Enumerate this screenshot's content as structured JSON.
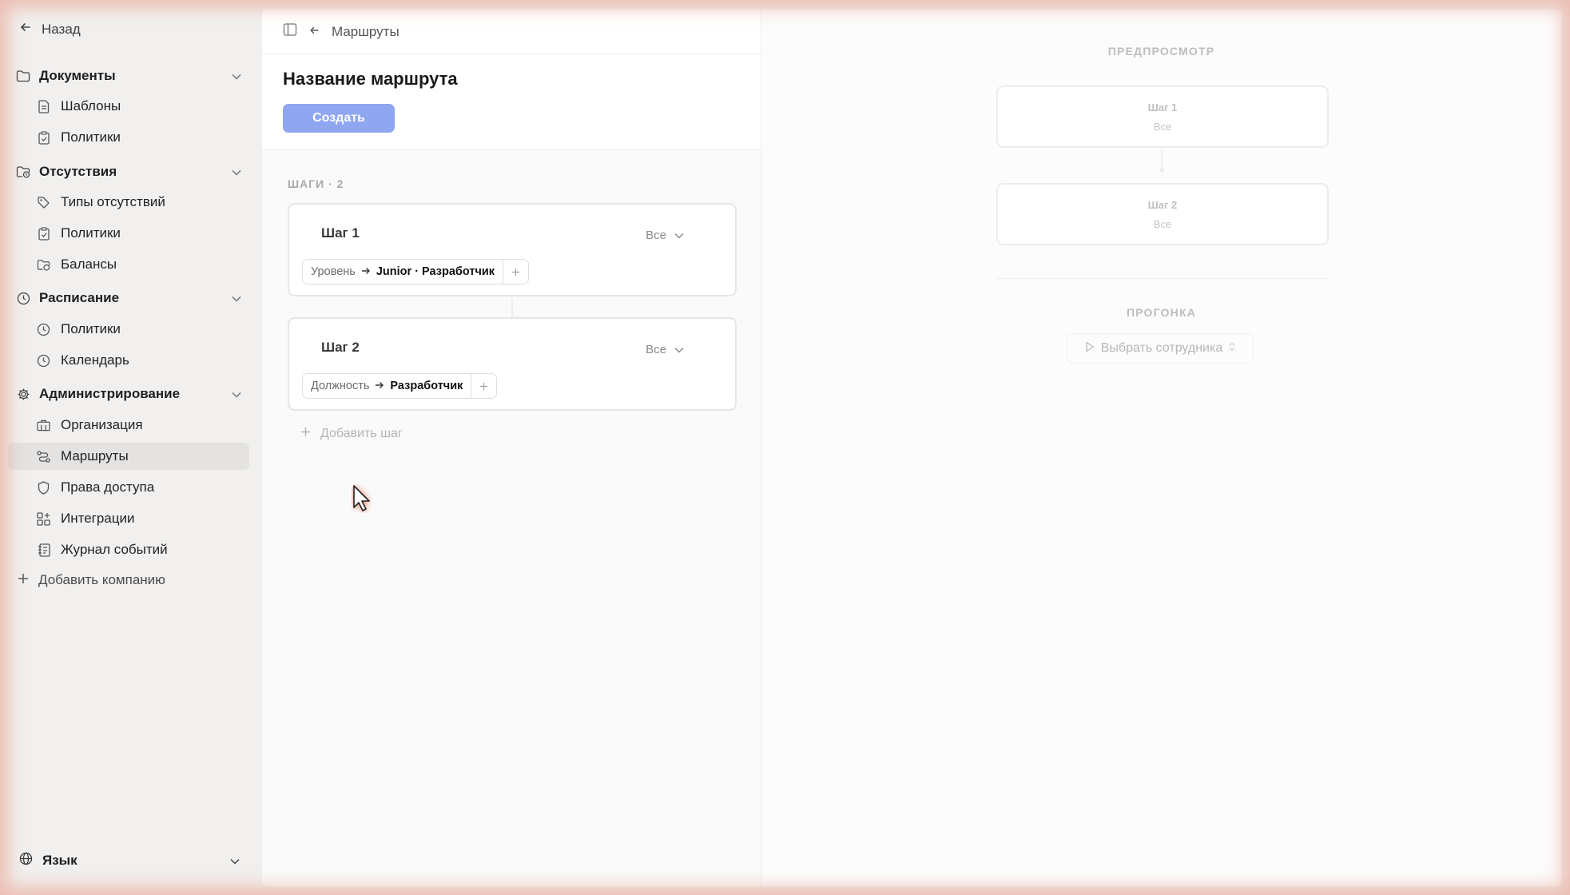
{
  "sidebar": {
    "back_label": "Назад",
    "groups": [
      {
        "label": "Документы",
        "icon": "folder-icon",
        "items": [
          {
            "label": "Шаблоны",
            "icon": "document-icon"
          },
          {
            "label": "Политики",
            "icon": "clipboard-icon"
          }
        ]
      },
      {
        "label": "Отсутствия",
        "icon": "folder-clock-icon",
        "items": [
          {
            "label": "Типы отсутствий",
            "icon": "tag-icon"
          },
          {
            "label": "Политики",
            "icon": "clipboard-icon"
          },
          {
            "label": "Балансы",
            "icon": "folder-clock-icon"
          }
        ]
      },
      {
        "label": "Расписание",
        "icon": "clock-icon",
        "items": [
          {
            "label": "Политики",
            "icon": "clock-icon"
          },
          {
            "label": "Календарь",
            "icon": "clock-icon"
          }
        ]
      },
      {
        "label": "Администрирование",
        "icon": "gear-icon",
        "items": [
          {
            "label": "Организация",
            "icon": "building-icon"
          },
          {
            "label": "Маршруты",
            "icon": "route-icon",
            "active": true
          },
          {
            "label": "Права доступа",
            "icon": "shield-icon"
          },
          {
            "label": "Интеграции",
            "icon": "grid-plus-icon"
          },
          {
            "label": "Журнал событий",
            "icon": "log-icon"
          }
        ]
      }
    ],
    "add_company_label": "Добавить компанию",
    "language_label": "Язык"
  },
  "editor": {
    "breadcrumb": "Маршруты",
    "title": "Название маршрута",
    "create_label": "Создать",
    "steps_label": "ШАГИ · 2",
    "steps": [
      {
        "title": "Шаг 1",
        "mode": "Все",
        "condition_key": "Уровень",
        "condition_value": "Junior · Разработчик"
      },
      {
        "title": "Шаг 2",
        "mode": "Все",
        "condition_key": "Должность",
        "condition_value": "Разработчик"
      }
    ],
    "add_step_label": "Добавить шаг"
  },
  "preview": {
    "label": "ПРЕДПРОСМОТР",
    "steps": [
      {
        "title": "Шаг 1",
        "mode": "Все"
      },
      {
        "title": "Шаг 2",
        "mode": "Все"
      }
    ],
    "run_label": "ПРОГОНКА",
    "select_employee_label": "Выбрать сотрудника"
  },
  "colors": {
    "accent_button": "#8fa6f0",
    "active_item_bg": "#e4e3e2",
    "sidebar_bg": "#f1f0ef"
  }
}
